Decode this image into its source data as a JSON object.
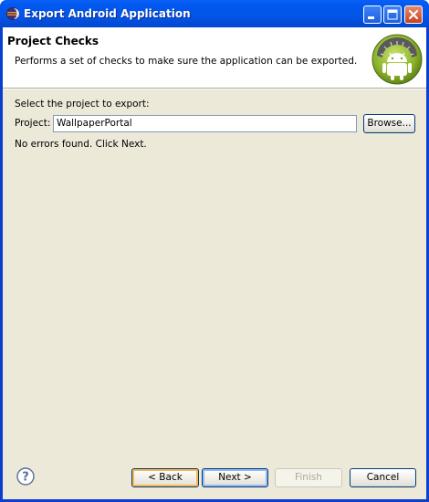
{
  "window": {
    "title": "Export Android Application"
  },
  "banner": {
    "title": "Project Checks",
    "description": "Performs a set of checks to make sure the application can be exported."
  },
  "form": {
    "instruction": "Select the project to export:",
    "project_label": "Project:",
    "project_value": "WallpaperPortal",
    "browse_label": "Browse...",
    "status": "No errors found. Click Next."
  },
  "buttons": {
    "back": "< Back",
    "next": "Next >",
    "finish": "Finish",
    "cancel": "Cancel"
  },
  "icons": {
    "title": "eclipse-icon",
    "logo": "android-logo-icon",
    "help": "help-icon"
  },
  "colors": {
    "titlebar": "#0058ee",
    "dialog_bg": "#ece9d8",
    "android_green": "#a4c639"
  }
}
